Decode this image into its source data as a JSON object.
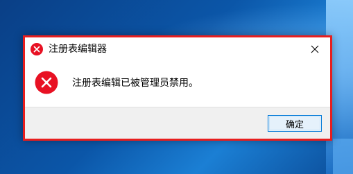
{
  "dialog": {
    "title": "注册表编辑器",
    "message": "注册表编辑已被管理员禁用。",
    "ok_label": "确定",
    "title_icon": "error-icon",
    "message_icon": "error-icon",
    "close_icon": "close-icon"
  },
  "colors": {
    "highlight_border": "#e81e1e",
    "error_red": "#e81123",
    "button_border": "#0078d7",
    "footer_bg": "#f0f0f0",
    "desktop_blue": "#0b56a8"
  }
}
